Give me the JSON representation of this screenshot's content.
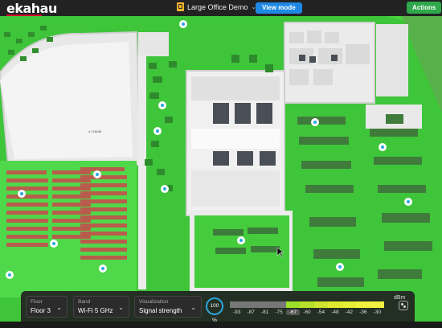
{
  "app": {
    "logo": "ekahau"
  },
  "header": {
    "project_name": "Large Office Demo",
    "view_mode_label": "View mode",
    "actions_label": "Actions"
  },
  "map": {
    "room_label": "4 178UM",
    "signal_color": "#44d13a",
    "access_points": 14
  },
  "controls": {
    "floor": {
      "label": "Floor",
      "value": "Floor 3"
    },
    "band": {
      "label": "Band",
      "value": "Wi-Fi 5 GHz"
    },
    "visualization": {
      "label": "Visualization",
      "value": "Signal strength"
    },
    "zoom": "100 %",
    "scale": {
      "unit": "dBm",
      "ticks": [
        "-93",
        "-87",
        "-81",
        "-75",
        "-67",
        "-60",
        "-54",
        "-48",
        "-42",
        "-36",
        "-30"
      ],
      "selected": "-67",
      "colors": [
        "#777",
        "#777",
        "#777",
        "#777",
        "#9ce02a",
        "#b7e12a",
        "#cde52c",
        "#dfea2e",
        "#e6ee36",
        "#eef03c",
        "#f2f240"
      ]
    }
  }
}
